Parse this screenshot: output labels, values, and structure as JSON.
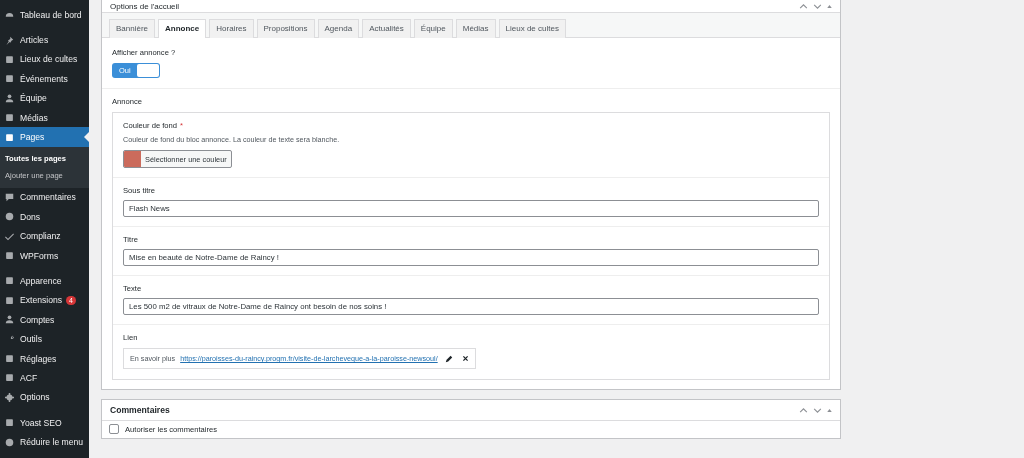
{
  "sidebar": {
    "groups": [
      {
        "items": [
          {
            "label": "Tableau de bord",
            "selected": false
          }
        ]
      },
      {
        "items": [
          {
            "label": "Articles",
            "selected": false
          },
          {
            "label": "Lieux de cultes",
            "selected": false
          },
          {
            "label": "Événements",
            "selected": false
          },
          {
            "label": "Équipe",
            "selected": false
          },
          {
            "label": "Médias",
            "selected": false
          },
          {
            "label": "Pages",
            "selected": true,
            "children": [
              {
                "label": "Toutes les pages",
                "selected": true
              },
              {
                "label": "Ajouter une page",
                "selected": false
              }
            ]
          },
          {
            "label": "Commentaires",
            "selected": false
          },
          {
            "label": "Dons",
            "selected": false
          },
          {
            "label": "Complianz",
            "selected": false
          },
          {
            "label": "WPForms",
            "selected": false
          }
        ]
      },
      {
        "items": [
          {
            "label": "Apparence",
            "selected": false
          },
          {
            "label": "Extensions",
            "selected": false,
            "badge": "4"
          },
          {
            "label": "Comptes",
            "selected": false
          },
          {
            "label": "Outils",
            "selected": false
          },
          {
            "label": "Réglages",
            "selected": false
          },
          {
            "label": "ACF",
            "selected": false
          },
          {
            "label": "Options",
            "selected": false
          }
        ]
      },
      {
        "items": [
          {
            "label": "Yoast SEO",
            "selected": false
          },
          {
            "label": "Réduire le menu",
            "selected": false
          }
        ]
      }
    ]
  },
  "options_panel": {
    "title": "Options de l'accueil",
    "tabs": [
      {
        "label": "Bannière",
        "selected": false
      },
      {
        "label": "Annonce",
        "selected": true
      },
      {
        "label": "Horaires",
        "selected": false
      },
      {
        "label": "Propositions",
        "selected": false
      },
      {
        "label": "Agenda",
        "selected": false
      },
      {
        "label": "Actualités",
        "selected": false
      },
      {
        "label": "Équipe",
        "selected": false
      },
      {
        "label": "Médias",
        "selected": false
      },
      {
        "label": "Lieux de cultes",
        "selected": false
      }
    ],
    "toggle": {
      "label": "Afficher annonce ?",
      "on": true,
      "on_text": "Oui"
    },
    "group": {
      "label": "Annonce",
      "fields": [
        {
          "kind": "color",
          "label": "Couleur de fond",
          "required_mark": "*",
          "description": "Couleur de fond du bloc annonce. La couleur de texte sera blanche.",
          "color": "#cb6b5c",
          "button": "Sélectionner une couleur"
        },
        {
          "kind": "text",
          "label": "Sous titre",
          "value": "Flash News"
        },
        {
          "kind": "text",
          "label": "Titre",
          "value": "Mise en beauté de Notre-Dame de Raincy !"
        },
        {
          "kind": "text",
          "label": "Texte",
          "value": "Les 500 m2 de vitraux de Notre-Dame de Raincy ont besoin de nos soins !"
        },
        {
          "kind": "link",
          "label": "Lien",
          "value": "En savoir plus",
          "url": "https://paroisses-du-raincy.progm.fr/visite-de-larcheveque-a-la-paroisse-newsoul/"
        }
      ]
    }
  },
  "comments_panel": {
    "title": "Commentaires",
    "checkbox": {
      "label": "Autoriser les commentaires",
      "checked": false
    }
  }
}
